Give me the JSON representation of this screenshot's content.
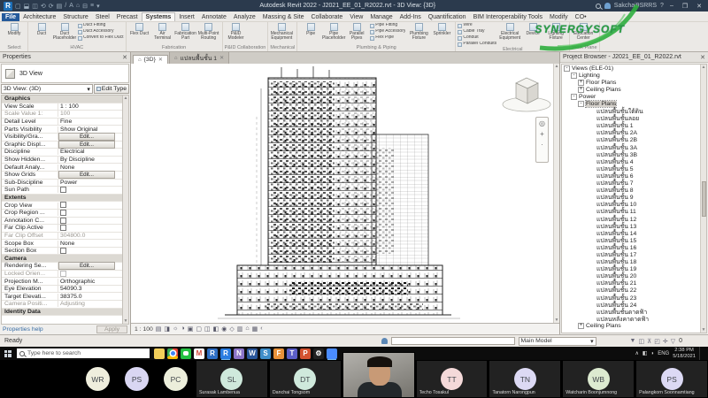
{
  "title_bar": {
    "app_initial": "R",
    "quick_access": [
      {
        "g": "▢",
        "n": "new-file-icon"
      },
      {
        "g": "⬓",
        "n": "open-file-icon"
      },
      {
        "g": "◫",
        "n": "save-icon"
      },
      {
        "g": "⟲",
        "n": "undo-icon"
      },
      {
        "g": "⟳",
        "n": "redo-icon"
      },
      {
        "g": "▤",
        "n": "print-icon"
      },
      {
        "g": "/",
        "n": "measure-icon"
      },
      {
        "g": "A",
        "n": "text-icon"
      },
      {
        "g": "⌂",
        "n": "default-3d-view-icon"
      },
      {
        "g": "⊟",
        "n": "section-icon"
      },
      {
        "g": "≡",
        "n": "thin-lines-icon"
      },
      {
        "g": "▾",
        "n": "customize-qat-icon"
      }
    ],
    "title": "Autodesk Revit 2022 - J2021_EE_01_R2022.rvt - 3D View: {3D}",
    "user": "Sakchai9SRRS",
    "help": "?"
  },
  "ribbon": {
    "tabs": [
      {
        "label": "File",
        "file": true
      },
      {
        "label": "Architecture"
      },
      {
        "label": "Structure"
      },
      {
        "label": "Steel"
      },
      {
        "label": "Precast"
      },
      {
        "label": "Systems",
        "active": true
      },
      {
        "label": "Insert"
      },
      {
        "label": "Annotate"
      },
      {
        "label": "Analyze"
      },
      {
        "label": "Massing & Site"
      },
      {
        "label": "Collaborate"
      },
      {
        "label": "View"
      },
      {
        "label": "Manage"
      },
      {
        "label": "Add-Ins"
      },
      {
        "label": "Quantification"
      },
      {
        "label": "BIM Interoperability Tools"
      },
      {
        "label": "Modify"
      },
      {
        "label": "CO•"
      }
    ],
    "groups": [
      {
        "label": "Select",
        "cols": [
          {
            "kind": "big",
            "items": [
              {
                "label": "Modify",
                "icon": "modify-icon"
              }
            ]
          }
        ]
      },
      {
        "label": "HVAC",
        "cols": [
          {
            "kind": "big",
            "items": [
              {
                "label": "Duct",
                "icon": "duct-icon"
              },
              {
                "label": "Duct Placeholder",
                "icon": "duct-placeholder-icon"
              }
            ]
          },
          {
            "kind": "stack",
            "items": [
              {
                "label": "Duct Fitting",
                "icon": "duct-fitting-icon"
              },
              {
                "label": "Duct Accessory",
                "icon": "duct-accessory-icon"
              },
              {
                "label": "Convert to Flex Duct",
                "icon": "convert-to-flex-duct-icon"
              }
            ]
          }
        ]
      },
      {
        "label": "Fabrication",
        "cols": [
          {
            "kind": "big",
            "items": [
              {
                "label": "Flex Duct",
                "icon": "flex-duct-icon"
              },
              {
                "label": "Air Terminal",
                "icon": "air-terminal-icon"
              },
              {
                "label": "Fabrication Part",
                "icon": "fabrication-part-icon"
              },
              {
                "label": "Multi-Point Routing",
                "icon": "multi-point-routing-icon"
              }
            ]
          }
        ]
      },
      {
        "label": "P&ID Collaboration",
        "cols": [
          {
            "kind": "big",
            "items": [
              {
                "label": "P&ID Modeler",
                "icon": "pid-modeler-icon"
              }
            ]
          }
        ]
      },
      {
        "label": "Mechanical",
        "cols": [
          {
            "kind": "big",
            "items": [
              {
                "label": "Mechanical Equipment",
                "icon": "mechanical-equipment-icon"
              }
            ]
          }
        ]
      },
      {
        "label": "Plumbing & Piping",
        "cols": [
          {
            "kind": "big",
            "items": [
              {
                "label": "Pipe",
                "icon": "pipe-icon"
              },
              {
                "label": "Pipe Placeholder",
                "icon": "pipe-placeholder-icon"
              },
              {
                "label": "Parallel Pipes",
                "icon": "parallel-pipes-icon"
              }
            ]
          },
          {
            "kind": "stack",
            "items": [
              {
                "label": "Pipe Fitting",
                "icon": "pipe-fitting-icon"
              },
              {
                "label": "Pipe Accessory",
                "icon": "pipe-accessory-icon"
              },
              {
                "label": "Flex Pipe",
                "icon": "flex-pipe-icon"
              }
            ]
          },
          {
            "kind": "big",
            "items": [
              {
                "label": "Plumbing Fixture",
                "icon": "plumbing-fixture-icon"
              },
              {
                "label": "Sprinkler",
                "icon": "sprinkler-icon"
              }
            ]
          }
        ]
      },
      {
        "label": "Electrical",
        "cols": [
          {
            "kind": "stack",
            "items": [
              {
                "label": "Wire",
                "icon": "wire-icon"
              },
              {
                "label": "Cable Tray",
                "icon": "cable-tray-icon"
              },
              {
                "label": "Conduit",
                "icon": "conduit-icon"
              },
              {
                "label": "Parallel Conduits",
                "icon": "parallel-conduits-icon"
              }
            ]
          },
          {
            "kind": "big",
            "items": [
              {
                "label": "Electrical Equipment",
                "icon": "electrical-equipment-icon"
              },
              {
                "label": "Device",
                "icon": "device-icon"
              },
              {
                "label": "Lighting Fixture",
                "icon": "lighting-fixture-icon"
              }
            ]
          }
        ]
      },
      {
        "label": "Work Plane",
        "cols": [
          {
            "kind": "big",
            "items": [
              {
                "label": "Education Center",
                "icon": "education-center-icon"
              }
            ]
          }
        ]
      }
    ],
    "watermark": "SYNERGYSOFT"
  },
  "properties": {
    "header": "Properties",
    "type_label": "3D View",
    "selector": "3D View: (3D)",
    "edit_type": "Edit Type",
    "rows": [
      {
        "label": "Graphics",
        "value": "",
        "kind": "section"
      },
      {
        "label": "View Scale",
        "value": "1 : 100",
        "kind": "text"
      },
      {
        "label": "Scale Value    1:",
        "value": "100",
        "kind": "muted"
      },
      {
        "label": "Detail Level",
        "value": "Fine",
        "kind": "text"
      },
      {
        "label": "Parts Visibility",
        "value": "Show Original",
        "kind": "text"
      },
      {
        "label": "Visibility/Gra...",
        "value": "Edit...",
        "kind": "button"
      },
      {
        "label": "Graphic Displ...",
        "value": "Edit...",
        "kind": "button"
      },
      {
        "label": "Discipline",
        "value": "Electrical",
        "kind": "text"
      },
      {
        "label": "Show Hidden...",
        "value": "By Discipline",
        "kind": "text"
      },
      {
        "label": "Default Analy...",
        "value": "None",
        "kind": "text"
      },
      {
        "label": "Show Grids",
        "value": "Edit...",
        "kind": "button"
      },
      {
        "label": "Sub-Discipline",
        "value": "Power",
        "kind": "text"
      },
      {
        "label": "Sun Path",
        "value": "",
        "kind": "check"
      },
      {
        "label": "Extents",
        "value": "",
        "kind": "section"
      },
      {
        "label": "Crop View",
        "value": "",
        "kind": "check"
      },
      {
        "label": "Crop Region ...",
        "value": "",
        "kind": "check"
      },
      {
        "label": "Annotation C...",
        "value": "",
        "kind": "check"
      },
      {
        "label": "Far Clip Active",
        "value": "",
        "kind": "check"
      },
      {
        "label": "Far Clip Offset",
        "value": "304800.0",
        "kind": "muted"
      },
      {
        "label": "Scope Box",
        "value": "None",
        "kind": "text"
      },
      {
        "label": "Section Box",
        "value": "",
        "kind": "check"
      },
      {
        "label": "Camera",
        "value": "",
        "kind": "section"
      },
      {
        "label": "Rendering Se...",
        "value": "Edit...",
        "kind": "button"
      },
      {
        "label": "Locked Orien...",
        "value": "",
        "kind": "checkmuted"
      },
      {
        "label": "Projection M...",
        "value": "Orthographic",
        "kind": "text"
      },
      {
        "label": "Eye Elevation",
        "value": "54090.3",
        "kind": "text"
      },
      {
        "label": "Target Elevati...",
        "value": "38375.0",
        "kind": "text"
      },
      {
        "label": "Camera Positi...",
        "value": "Adjusting",
        "kind": "muted"
      },
      {
        "label": "Identity Data",
        "value": "",
        "kind": "section"
      }
    ],
    "help": "Properties help",
    "apply": "Apply"
  },
  "viewport": {
    "tabs": [
      {
        "label": "{3D}",
        "active": true
      },
      {
        "label": "แปลนพื้นชั้น 1",
        "active": false
      }
    ],
    "scale": "1 : 100",
    "vcb_icons": [
      {
        "g": "▤",
        "n": "detail-level-icon"
      },
      {
        "g": "◨",
        "n": "visual-style-icon"
      },
      {
        "g": "☼",
        "n": "sun-path-icon"
      },
      {
        "g": "◑",
        "n": "shadows-icon"
      },
      {
        "g": "▣",
        "n": "rendering-dialog-icon"
      },
      {
        "g": "▢",
        "n": "crop-view-icon"
      },
      {
        "g": "◫",
        "n": "crop-region-icon"
      },
      {
        "g": "◧",
        "n": "temporary-hide-isolate-icon"
      },
      {
        "g": "◉",
        "n": "reveal-hidden-icon"
      },
      {
        "g": "◇",
        "n": "worksharing-display-icon"
      },
      {
        "g": "▥",
        "n": "temporary-view-properties-icon"
      },
      {
        "g": "⌂",
        "n": "analytical-model-icon"
      },
      {
        "g": "▦",
        "n": "displacement-icon"
      },
      {
        "g": "‹",
        "n": "vcb-expand-icon"
      }
    ]
  },
  "project_browser": {
    "header": "Project Browser - J2021_EE_01_R2022.rvt",
    "tree": [
      {
        "label": "Views (ELE-01)",
        "lvl": 0,
        "exp": "-"
      },
      {
        "label": "Lighting",
        "lvl": 1,
        "exp": "-"
      },
      {
        "label": "Floor Plans",
        "lvl": 2,
        "exp": "+"
      },
      {
        "label": "Ceiling Plans",
        "lvl": 2,
        "exp": "+"
      },
      {
        "label": "Power",
        "lvl": 1,
        "exp": "-"
      },
      {
        "label": "Floor Plans",
        "lvl": 2,
        "exp": "-",
        "sel": true
      },
      {
        "label": "แปลนพื้นชั้นใต้ดิน",
        "lvl": 3,
        "exp": ""
      },
      {
        "label": "แปลนพื้นชั้นลอย",
        "lvl": 3,
        "exp": ""
      },
      {
        "label": "แปลนพื้นชั้น 1",
        "lvl": 3,
        "exp": ""
      },
      {
        "label": "แปลนพื้นชั้น 2A",
        "lvl": 3,
        "exp": ""
      },
      {
        "label": "แปลนพื้นชั้น 2B",
        "lvl": 3,
        "exp": ""
      },
      {
        "label": "แปลนพื้นชั้น 3A",
        "lvl": 3,
        "exp": ""
      },
      {
        "label": "แปลนพื้นชั้น 3B",
        "lvl": 3,
        "exp": ""
      },
      {
        "label": "แปลนพื้นชั้น 4",
        "lvl": 3,
        "exp": ""
      },
      {
        "label": "แปลนพื้นชั้น 5",
        "lvl": 3,
        "exp": ""
      },
      {
        "label": "แปลนพื้นชั้น 6",
        "lvl": 3,
        "exp": ""
      },
      {
        "label": "แปลนพื้นชั้น 7",
        "lvl": 3,
        "exp": ""
      },
      {
        "label": "แปลนพื้นชั้น 8",
        "lvl": 3,
        "exp": ""
      },
      {
        "label": "แปลนพื้นชั้น 9",
        "lvl": 3,
        "exp": ""
      },
      {
        "label": "แปลนพื้นชั้น 10",
        "lvl": 3,
        "exp": ""
      },
      {
        "label": "แปลนพื้นชั้น 11",
        "lvl": 3,
        "exp": ""
      },
      {
        "label": "แปลนพื้นชั้น 12",
        "lvl": 3,
        "exp": ""
      },
      {
        "label": "แปลนพื้นชั้น 13",
        "lvl": 3,
        "exp": ""
      },
      {
        "label": "แปลนพื้นชั้น 14",
        "lvl": 3,
        "exp": ""
      },
      {
        "label": "แปลนพื้นชั้น 15",
        "lvl": 3,
        "exp": ""
      },
      {
        "label": "แปลนพื้นชั้น 16",
        "lvl": 3,
        "exp": ""
      },
      {
        "label": "แปลนพื้นชั้น 17",
        "lvl": 3,
        "exp": ""
      },
      {
        "label": "แปลนพื้นชั้น 18",
        "lvl": 3,
        "exp": ""
      },
      {
        "label": "แปลนพื้นชั้น 19",
        "lvl": 3,
        "exp": ""
      },
      {
        "label": "แปลนพื้นชั้น 20",
        "lvl": 3,
        "exp": ""
      },
      {
        "label": "แปลนพื้นชั้น 21",
        "lvl": 3,
        "exp": ""
      },
      {
        "label": "แปลนพื้นชั้น 22",
        "lvl": 3,
        "exp": ""
      },
      {
        "label": "แปลนพื้นชั้น 23",
        "lvl": 3,
        "exp": ""
      },
      {
        "label": "แปลนพื้นชั้น 24",
        "lvl": 3,
        "exp": ""
      },
      {
        "label": "แปลนพื้นชั้นดาดฟ้า",
        "lvl": 3,
        "exp": ""
      },
      {
        "label": "แปลนหลังคาดาดฟ้า",
        "lvl": 3,
        "exp": ""
      },
      {
        "label": "Ceiling Plans",
        "lvl": 2,
        "exp": "+"
      }
    ]
  },
  "status_bar": {
    "ready": "Ready",
    "main_model": "Main Model",
    "toggles": [
      {
        "g": "▼",
        "n": "select-links-icon"
      },
      {
        "g": "◫",
        "n": "select-underlay-icon"
      },
      {
        "g": "⊼",
        "n": "select-pinned-icon"
      },
      {
        "g": "◰",
        "n": "select-by-face-icon"
      },
      {
        "g": "✛",
        "n": "drag-on-selection-icon"
      },
      {
        "g": "▽",
        "n": "filter-icon"
      }
    ],
    "filter_count": "0"
  },
  "taskbar": {
    "search_placeholder": "Type here to search",
    "apps": [
      {
        "g": "",
        "n": "file-explorer-icon",
        "bg": "#f3cf5a",
        "fg": "#7a5b00"
      },
      {
        "g": "",
        "n": "chrome-icon",
        "bg": "",
        "fg": ""
      },
      {
        "g": "",
        "n": "line-icon",
        "bg": "#24c242",
        "fg": "#fff"
      },
      {
        "g": "M",
        "n": "gmail-icon",
        "bg": "#ffffff",
        "fg": "#d54c3f"
      },
      {
        "g": "R",
        "n": "revit-2021-icon",
        "bg": "#2f6fc4",
        "fg": "#ffffff"
      },
      {
        "g": "R",
        "n": "revit-2022-icon",
        "bg": "#2a7de1",
        "fg": "#ffffff",
        "active": true
      },
      {
        "g": "N",
        "n": "notepadpp-icon",
        "bg": "#8b74c9",
        "fg": "#ffffff"
      },
      {
        "g": "W",
        "n": "word-icon",
        "bg": "#2b579a",
        "fg": "#ffffff"
      },
      {
        "g": "S",
        "n": "skype-icon",
        "bg": "#3f8ec9",
        "fg": "#ffffff"
      },
      {
        "g": "F",
        "n": "f-app-icon",
        "bg": "#e8923a",
        "fg": "#ffffff"
      },
      {
        "g": "T",
        "n": "teams-icon",
        "bg": "#5b5fc7",
        "fg": "#ffffff"
      },
      {
        "g": "P",
        "n": "powerpoint-icon",
        "bg": "#d35230",
        "fg": "#ffffff"
      },
      {
        "g": "⚙",
        "n": "settings-icon",
        "bg": "#222222",
        "fg": "#ffffff"
      },
      {
        "g": "",
        "n": "zoom-icon",
        "bg": "#4a8cff",
        "fg": "#ffffff",
        "active": true
      }
    ],
    "tray": {
      "expand": "∧",
      "lang": "ENG",
      "time": "2:38 PM",
      "date": "5/18/2021"
    }
  },
  "zoom_bar": {
    "participants": [
      {
        "kind": "float",
        "initials": "WR",
        "name": "",
        "color": "#efeedd"
      },
      {
        "kind": "float",
        "initials": "PS",
        "name": "",
        "color": "#d9d6f2"
      },
      {
        "kind": "float",
        "initials": "PC",
        "name": "",
        "color": "#eceedb"
      },
      {
        "kind": "tile",
        "initials": "SL",
        "name": "Surasak Lambenua",
        "color": "#cfe9dc"
      },
      {
        "kind": "tile",
        "initials": "DT",
        "name": "Danchai Tongsom",
        "color": "#cfe9dc"
      },
      {
        "kind": "video",
        "initials": "",
        "name": "",
        "color": ""
      },
      {
        "kind": "tile",
        "initials": "TT",
        "name": "Techo Tosakul",
        "color": "#f4d9d9"
      },
      {
        "kind": "tile",
        "initials": "TN",
        "name": "Tanatorn Narongpun",
        "color": "#dcd9f4"
      },
      {
        "kind": "tile",
        "initials": "WB",
        "name": "Watcharin Boonjumnong",
        "color": "#dcead0"
      },
      {
        "kind": "tile",
        "initials": "PS",
        "name": "Palangkorn Soonnamtiang",
        "color": "#dcd9f4"
      }
    ]
  }
}
